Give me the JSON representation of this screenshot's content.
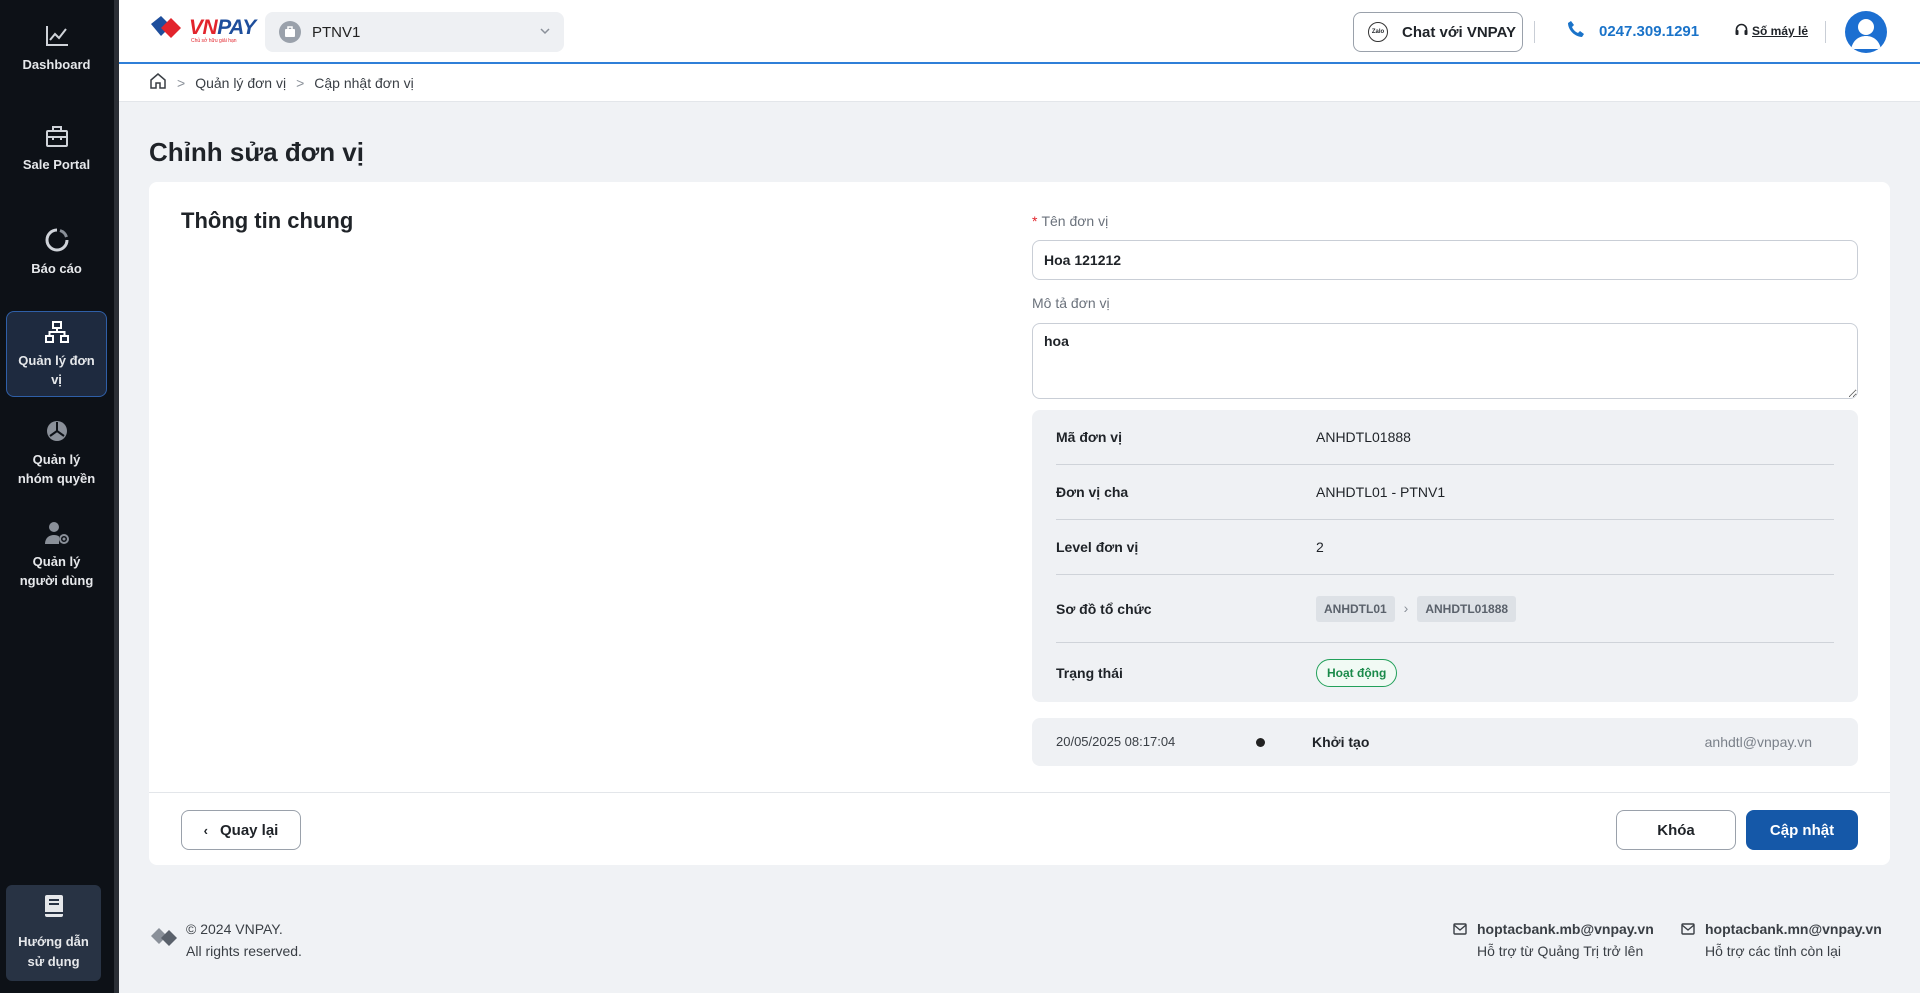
{
  "sidebar": {
    "items": [
      {
        "label": "Dashboard",
        "icon": "chart-line-icon"
      },
      {
        "label": "Sale Portal",
        "icon": "store-icon"
      },
      {
        "label": "Báo cáo",
        "icon": "report-icon"
      },
      {
        "label": "Quản lý đơn vị",
        "icon": "org-tree-icon",
        "active": true
      },
      {
        "label": "Quản lý nhóm quyền",
        "icon": "group-icon"
      },
      {
        "label": "Quản lý người dùng",
        "icon": "user-gear-icon"
      }
    ],
    "help": {
      "label": "Hướng dẫn sử dụng",
      "icon": "book-icon"
    }
  },
  "header": {
    "logo_text_a": "VN",
    "logo_text_b": "PAY",
    "logo_tagline": "Chủ sở hữu giải hạn",
    "org_select": "PTNV1",
    "chat_button": "Chat với VNPAY",
    "chat_icon_text": "Zalo",
    "hotline": "0247.309.1291",
    "extension": "Số máy lẻ"
  },
  "breadcrumb": {
    "items": [
      "Quản lý đơn vị",
      "Cập nhật đơn vị"
    ],
    "separator": ">"
  },
  "page": {
    "title": "Chỉnh sửa đơn vị",
    "section_title": "Thông tin chung"
  },
  "form": {
    "name_label": "Tên đơn vị",
    "name_required": "*",
    "name_value": "Hoa 121212",
    "desc_label": "Mô tả đơn vị",
    "desc_value": "hoa",
    "info": {
      "code_label": "Mã đơn vị",
      "code_value": "ANHDTL01888",
      "parent_label": "Đơn vị cha",
      "parent_value": "ANHDTL01 - PTNV1",
      "level_label": "Level đơn vị",
      "level_value": "2",
      "tree_label": "Sơ đồ tổ chức",
      "tree_nodes": [
        "ANHDTL01",
        "ANHDTL01888"
      ],
      "status_label": "Trạng thái",
      "status_value": "Hoạt động"
    },
    "log": {
      "time": "20/05/2025 08:17:04",
      "action": "Khởi tạo",
      "user": "anhdtl@vnpay.vn"
    }
  },
  "actions": {
    "back": "Quay lại",
    "lock": "Khóa",
    "update": "Cập nhật"
  },
  "footer": {
    "copyright_line1": "© 2024 VNPAY.",
    "copyright_line2": "All rights reserved.",
    "contacts": [
      {
        "email": "hoptacbank.mb@vnpay.vn",
        "note": "Hỗ trợ từ Quảng Trị trở lên"
      },
      {
        "email": "hoptacbank.mn@vnpay.vn",
        "note": "Hỗ trợ các tỉnh còn lại"
      }
    ]
  },
  "colors": {
    "primary": "#1558a8",
    "sidebar_bg": "#0d1117",
    "status_green": "#22a05a",
    "required_red": "#e2242c"
  }
}
